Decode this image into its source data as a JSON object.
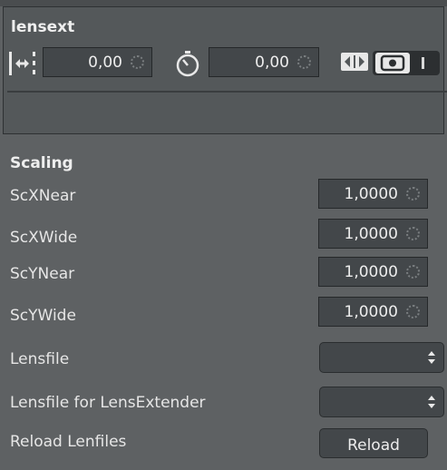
{
  "panel": {
    "title": "lensext",
    "offset_value": "0,00",
    "time_value": "0,00",
    "icons": [
      "offset-icon",
      "timer-icon",
      "swap-icon",
      "camera-icon"
    ]
  },
  "scaling": {
    "title": "Scaling",
    "rows": [
      {
        "label": "ScXNear",
        "value": "1,0000"
      },
      {
        "label": "ScXWide",
        "value": "1,0000"
      },
      {
        "label": "ScYNear",
        "value": "1,0000"
      },
      {
        "label": "ScYWide",
        "value": "1,0000"
      }
    ]
  },
  "lensfile": {
    "label": "Lensfile",
    "value": ""
  },
  "lensfile_extender": {
    "label": "Lensfile for LensExtender",
    "value": ""
  },
  "reload": {
    "label": "Reload Lenfiles",
    "button": "Reload"
  }
}
